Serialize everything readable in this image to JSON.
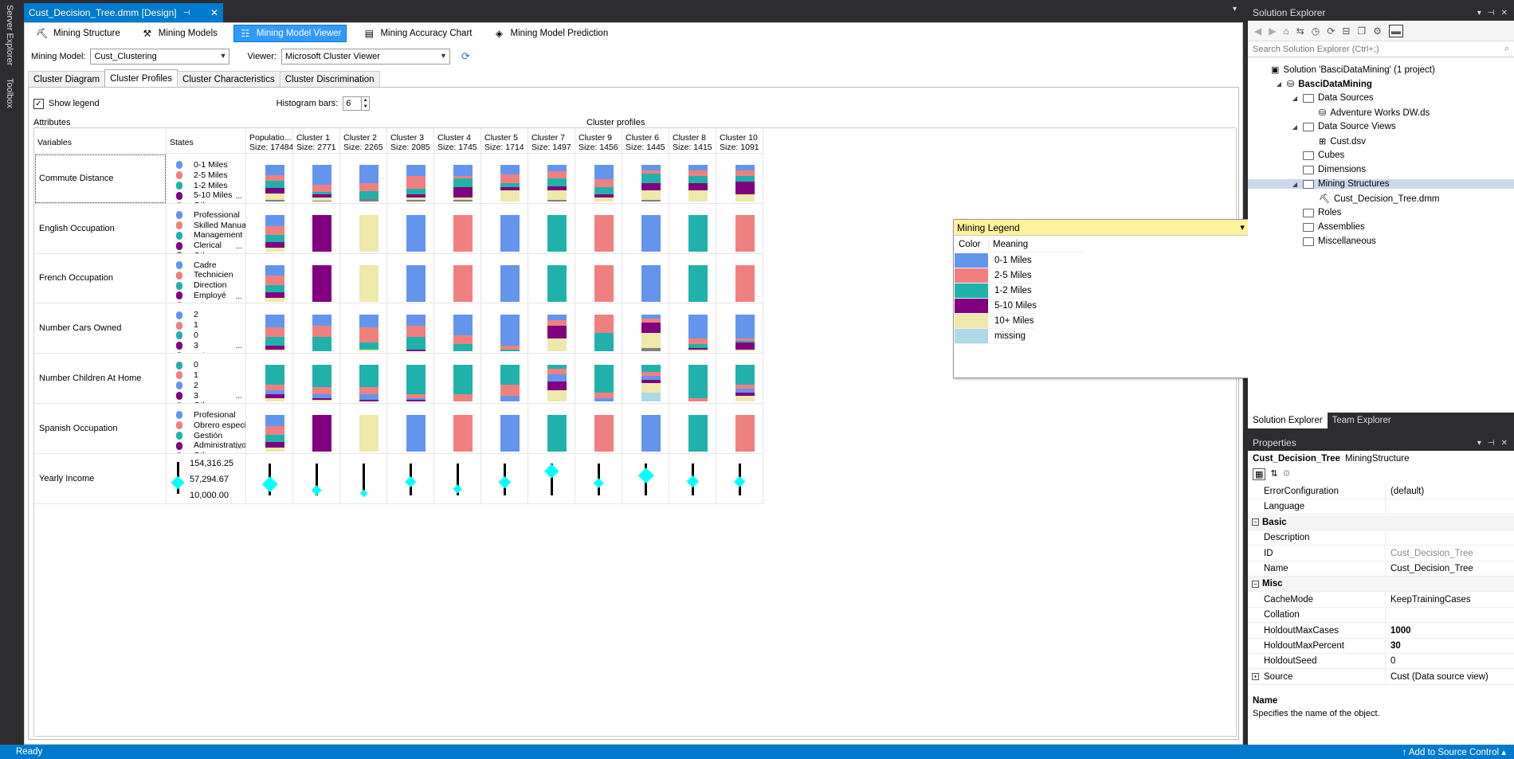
{
  "left_strip": {
    "tabs": [
      "Server Explorer",
      "Toolbox"
    ]
  },
  "doc_tab": {
    "title": "Cust_Decision_Tree.dmm [Design]",
    "pin": "⊣",
    "close": "✕"
  },
  "toolbar": {
    "buttons": [
      {
        "label": "Mining Structure",
        "icon": "mining-structure-icon",
        "glyph": "⛏"
      },
      {
        "label": "Mining Models",
        "icon": "mining-models-icon",
        "glyph": "⚒"
      },
      {
        "label": "Mining Model Viewer",
        "icon": "model-viewer-icon",
        "glyph": "☷",
        "active": true
      },
      {
        "label": "Mining Accuracy Chart",
        "icon": "accuracy-chart-icon",
        "glyph": "▤"
      },
      {
        "label": "Mining Model Prediction",
        "icon": "prediction-icon",
        "glyph": "◈"
      }
    ]
  },
  "model_row": {
    "model_label": "Mining Model:",
    "model_value": "Cust_Clustering",
    "viewer_label": "Viewer:",
    "viewer_value": "Microsoft Cluster Viewer"
  },
  "sub_tabs": [
    "Cluster Diagram",
    "Cluster Profiles",
    "Cluster Characteristics",
    "Cluster Discrimination"
  ],
  "active_sub_tab": 1,
  "options": {
    "show_legend_label": "Show legend",
    "show_legend_checked": true,
    "histogram_label": "Histogram bars:",
    "histogram_value": "6"
  },
  "grid": {
    "attributes_label": "Attributes",
    "profiles_label": "Cluster profiles",
    "variables_header": "Variables",
    "states_header": "States",
    "clusters": [
      {
        "name": "Populatio...",
        "size": "Size: 17484"
      },
      {
        "name": "Cluster 1",
        "size": "Size: 2771"
      },
      {
        "name": "Cluster 2",
        "size": "Size: 2265"
      },
      {
        "name": "Cluster 3",
        "size": "Size: 2085"
      },
      {
        "name": "Cluster 4",
        "size": "Size: 1745"
      },
      {
        "name": "Cluster 5",
        "size": "Size: 1714"
      },
      {
        "name": "Cluster 7",
        "size": "Size: 1497"
      },
      {
        "name": "Cluster 9",
        "size": "Size: 1456"
      },
      {
        "name": "Cluster 6",
        "size": "Size: 1445"
      },
      {
        "name": "Cluster 8",
        "size": "Size: 1415"
      },
      {
        "name": "Cluster 10",
        "size": "Size: 1091"
      }
    ],
    "colors": {
      "blue": "#6495ed",
      "salmon": "#f08080",
      "teal": "#20b2aa",
      "purple": "#800080",
      "cream": "#eee8aa",
      "gray": "#808080",
      "lightblue": "#add8e6"
    },
    "rows": [
      {
        "variable": "Commute Distance",
        "states": [
          [
            "0-1 Miles",
            "blue"
          ],
          [
            "2-5 Miles",
            "salmon"
          ],
          [
            "1-2 Miles",
            "teal"
          ],
          [
            "5-10 Miles",
            "purple"
          ],
          [
            "Other",
            "gray"
          ]
        ],
        "bars": [
          [
            0.28,
            0.15,
            0.2,
            0.15,
            0.17,
            0.05
          ],
          [
            0.55,
            0.2,
            0.05,
            0.1,
            0.08,
            0.02
          ],
          [
            0.5,
            0.22,
            0.22,
            0,
            0,
            0.06
          ],
          [
            0.3,
            0.35,
            0.15,
            0.1,
            0.06,
            0.04
          ],
          [
            0.3,
            0.08,
            0.22,
            0.3,
            0.05,
            0.05
          ],
          [
            0.25,
            0.25,
            0.1,
            0.1,
            0.3,
            0
          ],
          [
            0.18,
            0.18,
            0.22,
            0.12,
            0.25,
            0.05
          ],
          [
            0.4,
            0.2,
            0.2,
            0.1,
            0.1,
            0
          ],
          [
            0.15,
            0.1,
            0.25,
            0.2,
            0.25,
            0.05
          ],
          [
            0.15,
            0.15,
            0.2,
            0.2,
            0.3,
            0
          ],
          [
            0.15,
            0.15,
            0.15,
            0.35,
            0.2,
            0
          ]
        ]
      },
      {
        "variable": "English Occupation",
        "states": [
          [
            "Professional",
            "blue"
          ],
          [
            "Skilled Manual",
            "salmon"
          ],
          [
            "Management",
            "teal"
          ],
          [
            "Clerical",
            "purple"
          ],
          [
            "Other",
            "gray"
          ]
        ],
        "bars": [
          [
            0.3,
            0.25,
            0.2,
            0.15,
            0.1,
            0
          ],
          [
            0,
            0,
            0,
            1,
            0,
            0
          ],
          [
            0,
            0,
            0,
            0,
            1,
            0
          ],
          [
            1,
            0,
            0,
            0,
            0,
            0
          ],
          [
            0,
            1,
            0,
            0,
            0,
            0
          ],
          [
            1,
            0,
            0,
            0,
            0,
            0
          ],
          [
            0,
            0,
            1,
            0,
            0,
            0
          ],
          [
            0,
            1,
            0,
            0,
            0,
            0
          ],
          [
            1,
            0,
            0,
            0,
            0,
            0
          ],
          [
            0,
            0,
            1,
            0,
            0,
            0
          ],
          [
            0,
            1,
            0,
            0,
            0,
            0
          ]
        ]
      },
      {
        "variable": "French Occupation",
        "states": [
          [
            "Cadre",
            "blue"
          ],
          [
            "Technicien",
            "salmon"
          ],
          [
            "Direction",
            "teal"
          ],
          [
            "Employé",
            "purple"
          ],
          [
            "Other",
            "gray"
          ]
        ],
        "bars": [
          [
            0.3,
            0.25,
            0.2,
            0.15,
            0.1,
            0
          ],
          [
            0,
            0,
            0,
            1,
            0,
            0
          ],
          [
            0,
            0,
            0,
            0,
            1,
            0
          ],
          [
            1,
            0,
            0,
            0,
            0,
            0
          ],
          [
            0,
            1,
            0,
            0,
            0,
            0
          ],
          [
            1,
            0,
            0,
            0,
            0,
            0
          ],
          [
            0,
            0,
            1,
            0,
            0,
            0
          ],
          [
            0,
            1,
            0,
            0,
            0,
            0
          ],
          [
            1,
            0,
            0,
            0,
            0,
            0
          ],
          [
            0,
            0,
            1,
            0,
            0,
            0
          ],
          [
            0,
            1,
            0,
            0,
            0,
            0
          ]
        ]
      },
      {
        "variable": "Number Cars Owned",
        "states": [
          [
            "2",
            "blue"
          ],
          [
            "1",
            "salmon"
          ],
          [
            "0",
            "teal"
          ],
          [
            "3",
            "purple"
          ],
          [
            "Other",
            "gray"
          ]
        ],
        "bars": [
          [
            0.35,
            0.25,
            0.25,
            0.1,
            0.05,
            0
          ],
          [
            0.3,
            0.3,
            0.4,
            0,
            0,
            0
          ],
          [
            0.35,
            0.4,
            0.2,
            0,
            0.05,
            0
          ],
          [
            0.3,
            0.3,
            0.35,
            0.05,
            0,
            0
          ],
          [
            0.55,
            0.25,
            0.2,
            0,
            0,
            0
          ],
          [
            0.85,
            0.1,
            0.05,
            0,
            0,
            0
          ],
          [
            0.15,
            0.15,
            0,
            0.35,
            0.35,
            0
          ],
          [
            0,
            0.5,
            0.5,
            0,
            0,
            0
          ],
          [
            0.1,
            0.1,
            0,
            0.3,
            0.4,
            0.1
          ],
          [
            0.65,
            0.15,
            0.1,
            0.05,
            0.05,
            0
          ],
          [
            0.65,
            0.05,
            0.05,
            0.2,
            0.05,
            0
          ]
        ]
      },
      {
        "variable": "Number Children At Home",
        "states": [
          [
            "0",
            "teal"
          ],
          [
            "1",
            "salmon"
          ],
          [
            "2",
            "blue"
          ],
          [
            "3",
            "purple"
          ],
          [
            "Other",
            "gray"
          ]
        ],
        "bars": [
          [
            0.55,
            0.15,
            0.1,
            0.1,
            0.1,
            0
          ],
          [
            0.6,
            0.2,
            0.1,
            0.05,
            0.05,
            0
          ],
          [
            0.6,
            0.2,
            0.15,
            0.05,
            0,
            0
          ],
          [
            0.8,
            0.1,
            0.05,
            0.05,
            0,
            0
          ],
          [
            0.8,
            0.2,
            0,
            0,
            0,
            0
          ],
          [
            0.55,
            0.3,
            0.15,
            0,
            0,
            0
          ],
          [
            0.1,
            0.15,
            0.2,
            0.25,
            0.3,
            0
          ],
          [
            0.75,
            0.15,
            0.1,
            0,
            0,
            0
          ],
          [
            0.2,
            0.1,
            0.1,
            0.1,
            0.25,
            0.25
          ],
          [
            0.9,
            0.1,
            0,
            0,
            0,
            0
          ],
          [
            0.55,
            0.1,
            0.1,
            0.1,
            0.15,
            0
          ]
        ]
      },
      {
        "variable": "Spanish Occupation",
        "states": [
          [
            "Profesional",
            "blue"
          ],
          [
            "Obrero especiali",
            "salmon"
          ],
          [
            "Gestión",
            "teal"
          ],
          [
            "Administrativo",
            "purple"
          ],
          [
            "Other",
            "gray"
          ]
        ],
        "bars": [
          [
            0.3,
            0.25,
            0.2,
            0.15,
            0.1,
            0
          ],
          [
            0,
            0,
            0,
            1,
            0,
            0
          ],
          [
            0,
            0,
            0,
            0,
            1,
            0
          ],
          [
            1,
            0,
            0,
            0,
            0,
            0
          ],
          [
            0,
            1,
            0,
            0,
            0,
            0
          ],
          [
            1,
            0,
            0,
            0,
            0,
            0
          ],
          [
            0,
            0,
            1,
            0,
            0,
            0
          ],
          [
            0,
            1,
            0,
            0,
            0,
            0
          ],
          [
            1,
            0,
            0,
            0,
            0,
            0
          ],
          [
            0,
            0,
            1,
            0,
            0,
            0
          ],
          [
            0,
            1,
            0,
            0,
            0,
            0
          ]
        ]
      },
      {
        "variable": "Yearly Income",
        "numeric": true,
        "values": [
          "154,316.25",
          "57,294.67",
          "10,000.00"
        ],
        "diamonds": [
          [
            0.65,
            0.35
          ],
          [
            0.85,
            0.12
          ],
          [
            0.95,
            0.06
          ],
          [
            0.58,
            0.2
          ],
          [
            0.82,
            0.1
          ],
          [
            0.6,
            0.22
          ],
          [
            0.25,
            0.3
          ],
          [
            0.62,
            0.12
          ],
          [
            0.38,
            0.35
          ],
          [
            0.57,
            0.22
          ],
          [
            0.58,
            0.2
          ]
        ],
        "pop_diamond": [
          0.65,
          0.35
        ]
      }
    ],
    "more_glyph": "..."
  },
  "legend": {
    "title": "Mining Legend",
    "col_color": "Color",
    "col_meaning": "Meaning",
    "items": [
      [
        "0-1 Miles",
        "#6495ed"
      ],
      [
        "2-5 Miles",
        "#f08080"
      ],
      [
        "1-2 Miles",
        "#20b2aa"
      ],
      [
        "5-10 Miles",
        "#800080"
      ],
      [
        "10+ Miles",
        "#eee8aa"
      ],
      [
        "missing",
        "#add8e6"
      ]
    ]
  },
  "solution_explorer": {
    "title": "Solution Explorer",
    "search_placeholder": "Search Solution Explorer (Ctrl+;)",
    "tree": [
      {
        "label": "Solution 'BasciDataMining' (1 project)",
        "level": 0,
        "icon": "solution-icon"
      },
      {
        "label": "BasciDataMining",
        "level": 1,
        "bold": true,
        "icon": "project-icon"
      },
      {
        "label": "Data Sources",
        "level": 2,
        "icon": "folder-icon"
      },
      {
        "label": "Adventure Works DW.ds",
        "level": 3,
        "icon": "datasource-icon"
      },
      {
        "label": "Data Source Views",
        "level": 2,
        "icon": "folder-icon"
      },
      {
        "label": "Cust.dsv",
        "level": 3,
        "icon": "dsv-icon"
      },
      {
        "label": "Cubes",
        "level": 2,
        "icon": "folder-icon"
      },
      {
        "label": "Dimensions",
        "level": 2,
        "icon": "folder-icon"
      },
      {
        "label": "Mining Structures",
        "level": 2,
        "icon": "folder-icon",
        "selected": true
      },
      {
        "label": "Cust_Decision_Tree.dmm",
        "level": 3,
        "icon": "mining-structure-icon"
      },
      {
        "label": "Roles",
        "level": 2,
        "icon": "folder-icon"
      },
      {
        "label": "Assemblies",
        "level": 2,
        "icon": "folder-icon"
      },
      {
        "label": "Miscellaneous",
        "level": 2,
        "icon": "folder-icon"
      }
    ],
    "tabs": [
      "Solution Explorer",
      "Team Explorer"
    ]
  },
  "properties": {
    "title": "Properties",
    "object_name": "Cust_Decision_Tree",
    "object_type": "MiningStructure",
    "rows": [
      {
        "name": "ErrorConfiguration",
        "value": "(default)"
      },
      {
        "name": "Language",
        "value": ""
      },
      {
        "name": "Basic",
        "category": true
      },
      {
        "name": "Description",
        "value": ""
      },
      {
        "name": "ID",
        "value": "Cust_Decision_Tree",
        "dim": true
      },
      {
        "name": "Name",
        "value": "Cust_Decision_Tree"
      },
      {
        "name": "Misc",
        "category": true
      },
      {
        "name": "CacheMode",
        "value": "KeepTrainingCases"
      },
      {
        "name": "Collation",
        "value": ""
      },
      {
        "name": "HoldoutMaxCases",
        "value": "1000",
        "bold": true
      },
      {
        "name": "HoldoutMaxPercent",
        "value": "30",
        "bold": true
      },
      {
        "name": "HoldoutSeed",
        "value": "0"
      },
      {
        "name": "Source",
        "value": "Cust (Data source view)",
        "expandable": true
      }
    ],
    "desc_title": "Name",
    "desc_text": "Specifies the name of the object."
  },
  "status": {
    "ready": "Ready",
    "source_control": "↑ Add to Source Control ▴"
  }
}
